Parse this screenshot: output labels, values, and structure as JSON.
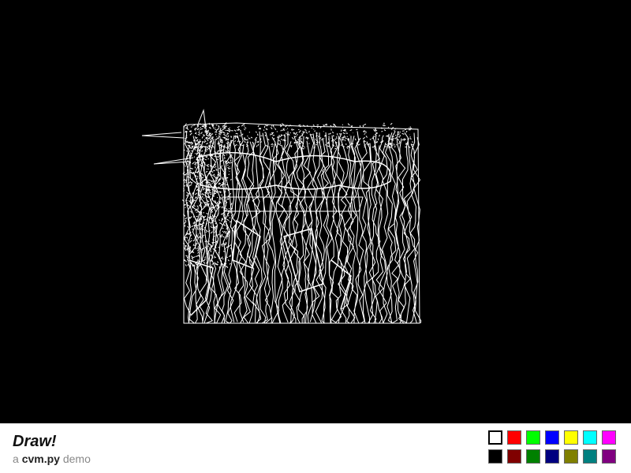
{
  "app": {
    "title": "Draw!",
    "subtitle_prefix": "a",
    "subtitle_module": "cvm.py",
    "subtitle_suffix": "demo"
  },
  "canvas": {
    "background": "#000000",
    "stroke_color": "#ffffff"
  },
  "palette": {
    "selected_index": 0,
    "top_row": [
      "#ffffff",
      "#ff0000",
      "#00ff00",
      "#0000ff",
      "#ffff00",
      "#00ffff",
      "#ff00ff"
    ],
    "bottom_row": [
      "#000000",
      "#800000",
      "#008000",
      "#000080",
      "#808000",
      "#008080",
      "#800080"
    ]
  }
}
